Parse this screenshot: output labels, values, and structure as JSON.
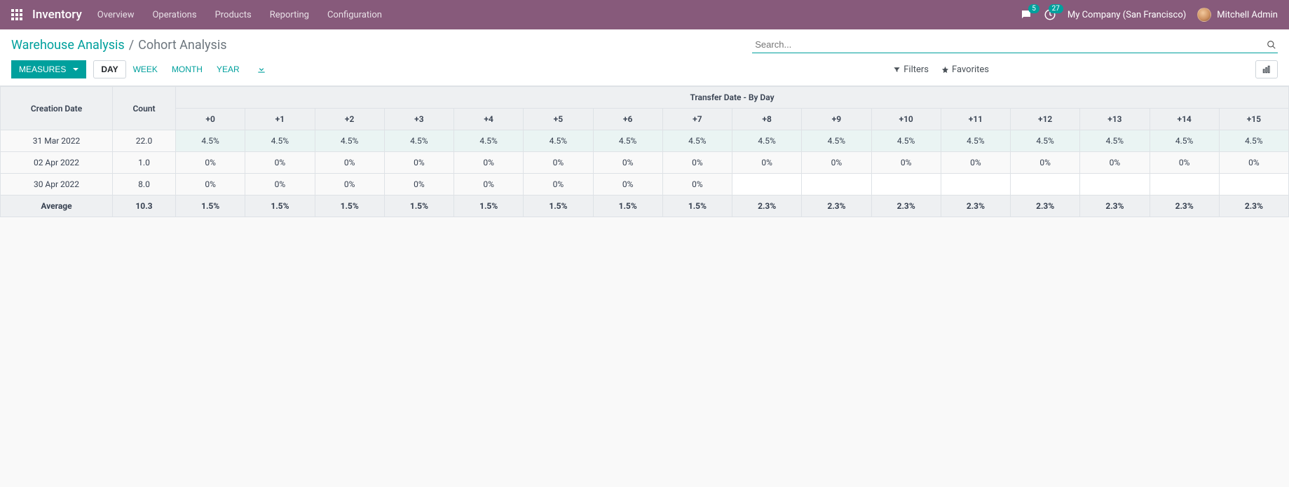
{
  "navbar": {
    "brand": "Inventory",
    "menu": [
      "Overview",
      "Operations",
      "Products",
      "Reporting",
      "Configuration"
    ],
    "chat_count": "5",
    "activity_count": "27",
    "company": "My Company (San Francisco)",
    "user": "Mitchell Admin"
  },
  "breadcrumb": {
    "link": "Warehouse Analysis",
    "sep": "/",
    "current": "Cohort Analysis"
  },
  "search": {
    "placeholder": "Search..."
  },
  "toolbar": {
    "measures": "MEASURES",
    "intervals": [
      "DAY",
      "WEEK",
      "MONTH",
      "YEAR"
    ],
    "active_interval": "DAY"
  },
  "filters": {
    "filters": "Filters",
    "favorites": "Favorites"
  },
  "table": {
    "group_header": "Transfer Date - By Day",
    "row_header": "Creation Date",
    "count_header": "Count",
    "offsets": [
      "+0",
      "+1",
      "+2",
      "+3",
      "+4",
      "+5",
      "+6",
      "+7",
      "+8",
      "+9",
      "+10",
      "+11",
      "+12",
      "+13",
      "+14",
      "+15"
    ],
    "rows": [
      {
        "label": "31 Mar 2022",
        "count": "22.0",
        "cells": [
          "4.5%",
          "4.5%",
          "4.5%",
          "4.5%",
          "4.5%",
          "4.5%",
          "4.5%",
          "4.5%",
          "4.5%",
          "4.5%",
          "4.5%",
          "4.5%",
          "4.5%",
          "4.5%",
          "4.5%",
          "4.5%"
        ],
        "shade": true
      },
      {
        "label": "02 Apr 2022",
        "count": "1.0",
        "cells": [
          "0%",
          "0%",
          "0%",
          "0%",
          "0%",
          "0%",
          "0%",
          "0%",
          "0%",
          "0%",
          "0%",
          "0%",
          "0%",
          "0%",
          "0%",
          "0%"
        ],
        "shade": false
      },
      {
        "label": "30 Apr 2022",
        "count": "8.0",
        "cells": [
          "0%",
          "0%",
          "0%",
          "0%",
          "0%",
          "0%",
          "0%",
          "0%",
          "",
          "",
          "",
          "",
          "",
          "",
          "",
          ""
        ],
        "shade": false
      }
    ],
    "average": {
      "label": "Average",
      "count": "10.3",
      "cells": [
        "1.5%",
        "1.5%",
        "1.5%",
        "1.5%",
        "1.5%",
        "1.5%",
        "1.5%",
        "1.5%",
        "2.3%",
        "2.3%",
        "2.3%",
        "2.3%",
        "2.3%",
        "2.3%",
        "2.3%",
        "2.3%"
      ]
    }
  },
  "chart_data": {
    "type": "table",
    "title": "Cohort Analysis — Transfer Date - By Day",
    "row_dimension": "Creation Date",
    "column_dimension": "Transfer Date offset (days)",
    "columns": [
      "+0",
      "+1",
      "+2",
      "+3",
      "+4",
      "+5",
      "+6",
      "+7",
      "+8",
      "+9",
      "+10",
      "+11",
      "+12",
      "+13",
      "+14",
      "+15"
    ],
    "rows": [
      {
        "label": "31 Mar 2022",
        "count": 22.0,
        "values": [
          4.5,
          4.5,
          4.5,
          4.5,
          4.5,
          4.5,
          4.5,
          4.5,
          4.5,
          4.5,
          4.5,
          4.5,
          4.5,
          4.5,
          4.5,
          4.5
        ]
      },
      {
        "label": "02 Apr 2022",
        "count": 1.0,
        "values": [
          0,
          0,
          0,
          0,
          0,
          0,
          0,
          0,
          0,
          0,
          0,
          0,
          0,
          0,
          0,
          0
        ]
      },
      {
        "label": "30 Apr 2022",
        "count": 8.0,
        "values": [
          0,
          0,
          0,
          0,
          0,
          0,
          0,
          0,
          null,
          null,
          null,
          null,
          null,
          null,
          null,
          null
        ]
      }
    ],
    "average": {
      "label": "Average",
      "count": 10.3,
      "values": [
        1.5,
        1.5,
        1.5,
        1.5,
        1.5,
        1.5,
        1.5,
        1.5,
        2.3,
        2.3,
        2.3,
        2.3,
        2.3,
        2.3,
        2.3,
        2.3
      ]
    },
    "unit": "%"
  }
}
